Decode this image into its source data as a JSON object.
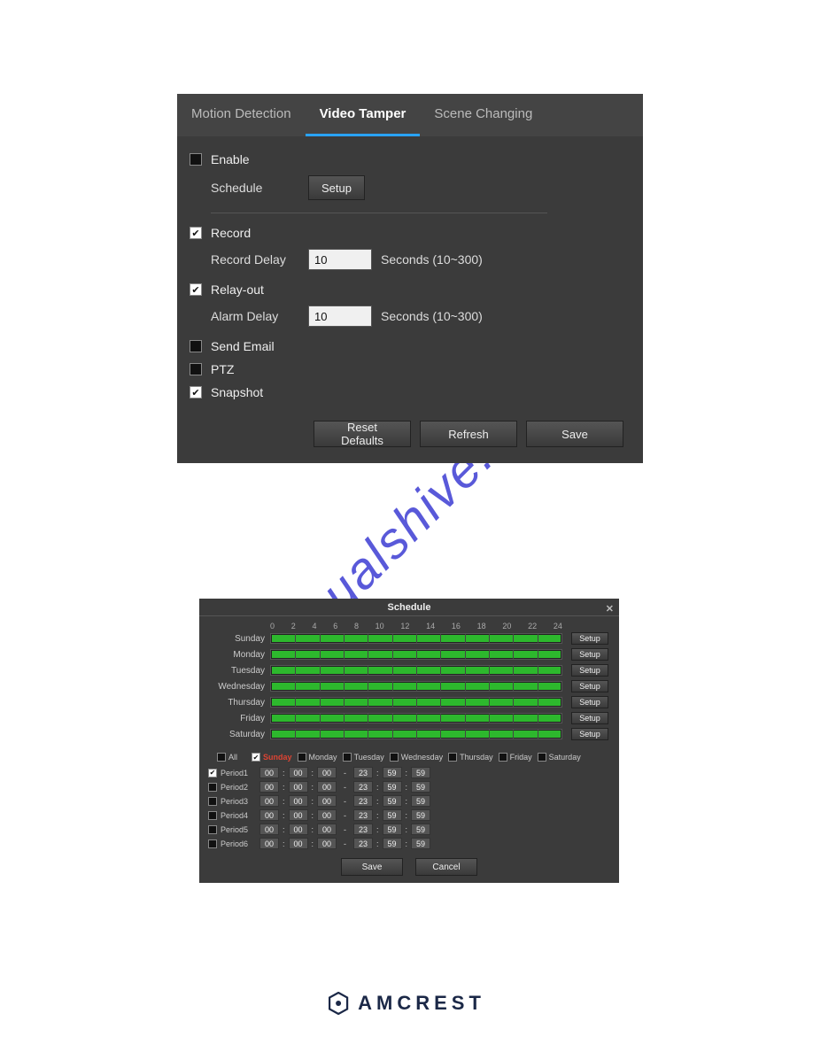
{
  "watermark": "manualshive.com",
  "panel1": {
    "tabs": [
      {
        "label": "Motion Detection",
        "active": false
      },
      {
        "label": "Video Tamper",
        "active": true
      },
      {
        "label": "Scene Changing",
        "active": false
      }
    ],
    "enable": {
      "label": "Enable",
      "checked": false
    },
    "schedule": {
      "label": "Schedule",
      "button": "Setup"
    },
    "record": {
      "label": "Record",
      "checked": true
    },
    "recordDelay": {
      "label": "Record Delay",
      "value": "10",
      "suffix": "Seconds (10~300)"
    },
    "relayOut": {
      "label": "Relay-out",
      "checked": true
    },
    "alarmDelay": {
      "label": "Alarm Delay",
      "value": "10",
      "suffix": "Seconds (10~300)"
    },
    "sendEmail": {
      "label": "Send Email",
      "checked": false
    },
    "ptz": {
      "label": "PTZ",
      "checked": false
    },
    "snapshot": {
      "label": "Snapshot",
      "checked": true
    },
    "actions": {
      "resetDefaults": "Reset Defaults",
      "refresh": "Refresh",
      "save": "Save"
    }
  },
  "panel2": {
    "title": "Schedule",
    "hourTicks": [
      "0",
      "2",
      "4",
      "6",
      "8",
      "10",
      "12",
      "14",
      "16",
      "18",
      "20",
      "22",
      "24"
    ],
    "days": [
      "Sunday",
      "Monday",
      "Tuesday",
      "Wednesday",
      "Thursday",
      "Friday",
      "Saturday"
    ],
    "rowSetupLabel": "Setup",
    "allLabel": "All",
    "dow": [
      {
        "label": "Sunday",
        "checked": true,
        "highlight": true
      },
      {
        "label": "Monday",
        "checked": false
      },
      {
        "label": "Tuesday",
        "checked": false
      },
      {
        "label": "Wednesday",
        "checked": false
      },
      {
        "label": "Thursday",
        "checked": false
      },
      {
        "label": "Friday",
        "checked": false
      },
      {
        "label": "Saturday",
        "checked": false
      }
    ],
    "periods": [
      {
        "name": "Period1",
        "checked": true,
        "from": [
          "00",
          "00",
          "00"
        ],
        "to": [
          "23",
          "59",
          "59"
        ]
      },
      {
        "name": "Period2",
        "checked": false,
        "from": [
          "00",
          "00",
          "00"
        ],
        "to": [
          "23",
          "59",
          "59"
        ]
      },
      {
        "name": "Period3",
        "checked": false,
        "from": [
          "00",
          "00",
          "00"
        ],
        "to": [
          "23",
          "59",
          "59"
        ]
      },
      {
        "name": "Period4",
        "checked": false,
        "from": [
          "00",
          "00",
          "00"
        ],
        "to": [
          "23",
          "59",
          "59"
        ]
      },
      {
        "name": "Period5",
        "checked": false,
        "from": [
          "00",
          "00",
          "00"
        ],
        "to": [
          "23",
          "59",
          "59"
        ]
      },
      {
        "name": "Period6",
        "checked": false,
        "from": [
          "00",
          "00",
          "00"
        ],
        "to": [
          "23",
          "59",
          "59"
        ]
      }
    ],
    "actions": {
      "save": "Save",
      "cancel": "Cancel"
    }
  },
  "logo": {
    "text": "AMCREST"
  }
}
